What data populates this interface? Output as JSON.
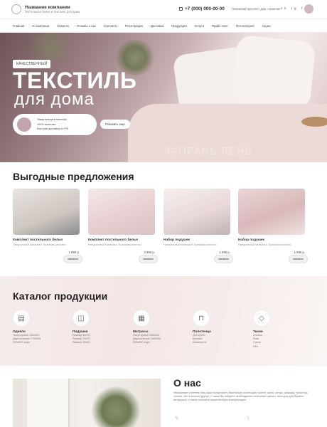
{
  "header": {
    "company_name": "Название компании",
    "company_tagline": "Постельное белье и текстиль для дома",
    "phone": "+7 (000) 000-00-00",
    "address": "Ленинский проспект дом, строение",
    "socials": [
      "vk",
      "tg",
      "f"
    ]
  },
  "nav": {
    "items": [
      "Главная",
      "О компании",
      "Новости",
      "Отзывы о нас",
      "Контакты",
      "Регистрация",
      "Доставка",
      "Продукция",
      "Услуги",
      "Прайс-лист",
      "Фотогалерея",
      "Акции"
    ]
  },
  "hero": {
    "badge": "КАЧЕСТВЕННЫЙ",
    "title_line1": "ТЕКСТИЛЬ",
    "title_line2": "для дома",
    "features": [
      "Товар всегда в наличии",
      "100% качество",
      "Быстрая доставка по РФ"
    ],
    "button_label": "Показать еще",
    "ghost_text": "ЗАПРАВЬ ЛЕНЬ"
  },
  "offers": {
    "title": "Выгодные предложения",
    "cards": [
      {
        "title": "Комплект постельного белья",
        "desc": "Натуральный материал. Премиум качество",
        "price": "1 990 р.",
        "button": "заказать"
      },
      {
        "title": "Комплект постельного белья",
        "desc": "Натуральный материал. Премиум качество",
        "price": "2 990 р.",
        "button": "заказать"
      },
      {
        "title": "Набор подушек",
        "desc": "Натуральный материал. Премиум качество",
        "price": "1 990 р.",
        "button": "заказать"
      },
      {
        "title": "Набор подушек",
        "desc": "Натуральный материал. Премиум качество",
        "price": "1 990 р.",
        "button": "заказать"
      }
    ]
  },
  "catalog": {
    "title": "Каталог продукции",
    "items": [
      {
        "title": "Одеяла",
        "lines": [
          "Полуторные 150х200",
          "Двуспальные 170х205",
          "200х220 евро"
        ]
      },
      {
        "title": "Подушки",
        "lines": [
          "Размер 50х70",
          "Размер 70х70",
          "Размер 40х40"
        ]
      },
      {
        "title": "Матрасы",
        "lines": [
          "Полуторные 150х200",
          "Двуспальные 160х200",
          "200х200 евро"
        ]
      },
      {
        "title": "Полотенца",
        "lines": [
          "Для кухни",
          "Банные",
          "Комплекты"
        ]
      },
      {
        "title": "Ткани",
        "lines": [
          "Хлопок",
          "Бязь",
          "Сатин",
          "Лён"
        ]
      }
    ]
  },
  "about": {
    "title": "О нас",
    "text": "Уважаемые клиенты! Мы рады предложить Вам новую коллекцию тканей: шелк, ситцы, жаккард, трикотаж, хлопок, лен и многое другое. С нами Вы найдёте необходимое сочетание цвета и текстуры для Вашего интерьера, а также получите качественную консультацию."
  }
}
